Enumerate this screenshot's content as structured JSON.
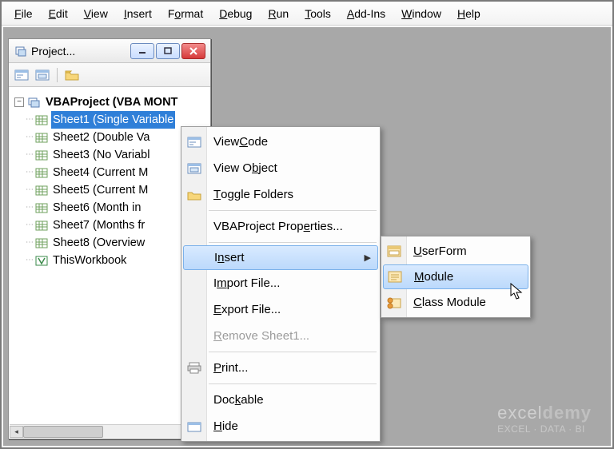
{
  "menubar": {
    "items": [
      {
        "label": "File",
        "accel": "F"
      },
      {
        "label": "Edit",
        "accel": "E"
      },
      {
        "label": "View",
        "accel": "V"
      },
      {
        "label": "Insert",
        "accel": "I"
      },
      {
        "label": "Format",
        "accel": "o"
      },
      {
        "label": "Debug",
        "accel": "D"
      },
      {
        "label": "Run",
        "accel": "R"
      },
      {
        "label": "Tools",
        "accel": "T"
      },
      {
        "label": "Add-Ins",
        "accel": "A"
      },
      {
        "label": "Window",
        "accel": "W"
      },
      {
        "label": "Help",
        "accel": "H"
      }
    ]
  },
  "project_panel": {
    "title": "Project...",
    "root": "VBAProject (VBA MONT",
    "items": [
      "Sheet1 (Single Variable",
      "Sheet2 (Double Va",
      "Sheet3 (No Variabl",
      "Sheet4 (Current M",
      "Sheet5 (Current M",
      "Sheet6 (Month in ",
      "Sheet7 (Months fr",
      "Sheet8 (Overview",
      "ThisWorkbook"
    ],
    "selected_index": 0
  },
  "context_menu": {
    "items": [
      {
        "label": "View Code",
        "accel": "C",
        "icon": "code-window-icon"
      },
      {
        "label": "View Object",
        "accel": "b",
        "icon": "object-window-icon"
      },
      {
        "label": "Toggle Folders",
        "accel": "T",
        "icon": "folder-icon"
      },
      {
        "sep": true
      },
      {
        "label": "VBAProject Properties...",
        "accel": "e"
      },
      {
        "sep": true
      },
      {
        "label": "Insert",
        "accel": "n",
        "submenu": true,
        "hover": true
      },
      {
        "label": "Import File...",
        "accel": "m"
      },
      {
        "label": "Export File...",
        "accel": "E"
      },
      {
        "label": "Remove Sheet1...",
        "accel": "R",
        "disabled": true
      },
      {
        "sep": true
      },
      {
        "label": "Print...",
        "accel": "P",
        "icon": "print-icon"
      },
      {
        "sep": true
      },
      {
        "label": "Dockable",
        "accel": "k"
      },
      {
        "label": "Hide",
        "accel": "H",
        "icon": "hide-icon"
      }
    ]
  },
  "insert_submenu": {
    "items": [
      {
        "label": "UserForm",
        "accel": "U",
        "icon": "userform-icon"
      },
      {
        "label": "Module",
        "accel": "M",
        "icon": "module-icon",
        "hover": true
      },
      {
        "label": "Class Module",
        "accel": "C",
        "icon": "class-module-icon"
      }
    ]
  },
  "watermark": {
    "brand_a": "excel",
    "brand_b": "demy",
    "tag": "EXCEL · DATA · BI"
  }
}
